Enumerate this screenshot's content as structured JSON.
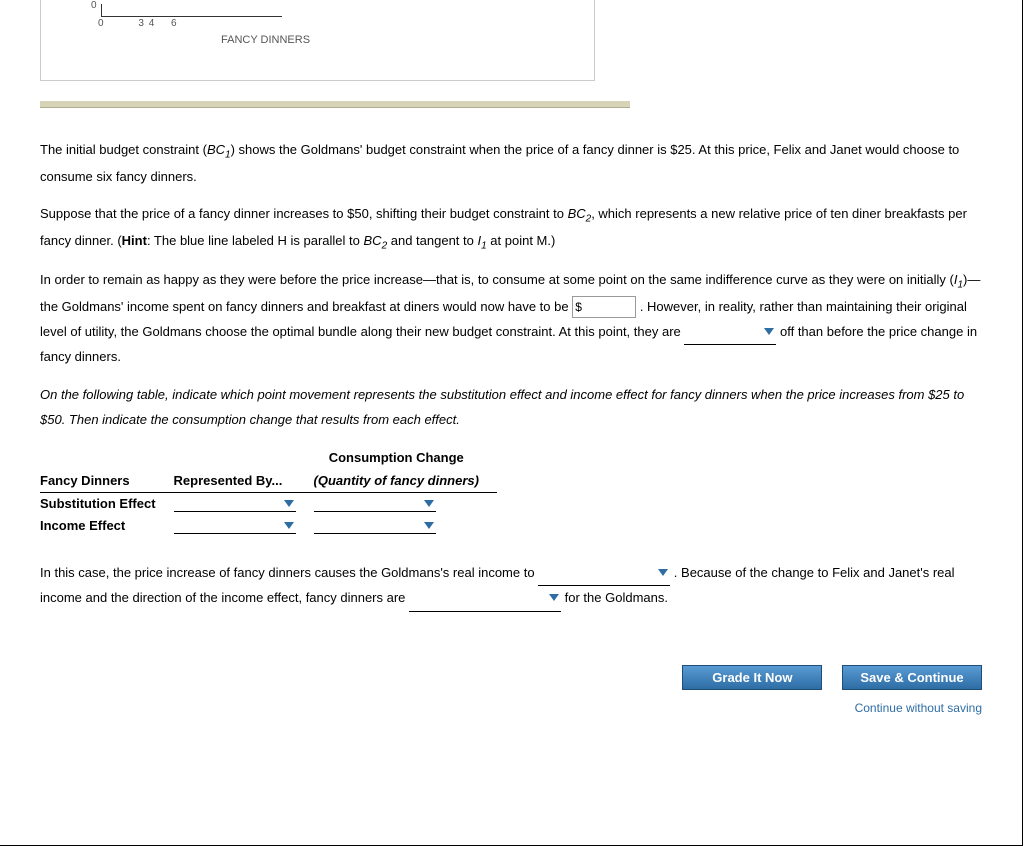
{
  "chart_data": {
    "type": "line",
    "xlabel": "FANCY DINNERS",
    "ylabel": "",
    "x_ticks": [
      "0",
      "3",
      "4",
      "6"
    ],
    "y_ticks": [
      "0"
    ]
  },
  "para1_a": "The initial budget constraint (",
  "para1_bc1": "BC",
  "para1_sub1": "1",
  "para1_b": ") shows the Goldmans' budget constraint when the price of a fancy dinner is $25. At this price, Felix and Janet would choose to consume six fancy dinners.",
  "para2_a": "Suppose that the price of a fancy dinner increases to $50, shifting their budget constraint to ",
  "para2_bc2": "BC",
  "para2_sub2": "2",
  "para2_b": ", which represents a new relative price of ten diner breakfasts per fancy dinner. (",
  "para2_hint": "Hint",
  "para2_c": ": The blue line labeled H is parallel to ",
  "para2_bc2b": "BC",
  "para2_sub2b": "2",
  "para2_d": " and tangent to ",
  "para2_I": "I",
  "para2_subI": "1",
  "para2_e": " at point M.)",
  "para3_a": "In order to remain as happy as they were before the price increase—that is, to consume at some point on the same indifference curve as they were on initially (",
  "para3_I": "I",
  "para3_subI": "1",
  "para3_b": ")—the Goldmans' income spent on fancy dinners and breakfast at diners would now have to be ",
  "input_prefix": "$",
  "para3_c": " . However, in reality, rather than maintaining their original level of utility, the Goldmans choose the optimal bundle along their new budget constraint. At this point, they are ",
  "para3_d": " off than before the price change in fancy dinners.",
  "para4": "On the following table, indicate which point movement represents the substitution effect and income effect for fancy dinners when the price increases from $25 to $50. Then indicate the consumption change that results from each effect.",
  "table": {
    "super_header": "Consumption Change",
    "col1": "Fancy Dinners",
    "col2": "Represented By...",
    "col3": "(Quantity of fancy dinners)",
    "row1": "Substitution Effect",
    "row2": "Income Effect"
  },
  "para5_a": "In this case, the price increase of fancy dinners causes the Goldmans's real income to ",
  "para5_b": " . Because of the change to Felix and Janet's real income and the direction of the income effect, fancy dinners are ",
  "para5_c": " for the Goldmans.",
  "buttons": {
    "grade": "Grade It Now",
    "save": "Save & Continue",
    "link": "Continue without saving"
  }
}
